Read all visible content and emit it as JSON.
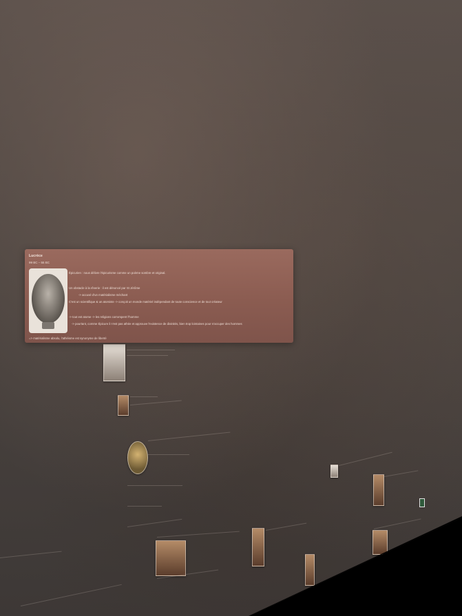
{
  "card": {
    "title": "Lucrèce",
    "dates": "99 BC – 55 BC",
    "lines": [
      "Épicurien : nous délivre l'épicurisme comme un poème sombre et original.",
      "Un obstacle à la rêverie : il est dénoncé par St Jérôme",
      "-> accusé d'un matérialisme méchant",
      "C'est un scientifique & un atomiste -> conçoit un monde matériel indépendant de toute conscience et de tout créateur",
      "-> tout est atome -> les religions corrompent l'homme",
      "-> pourtant, comme Épicure il n'est pas athée et approuve l'existence de divinités, bien trop lointaines pour s'occuper des hommes"
    ],
    "footer": "=> matérialisme absolu, l'athéisme est synonyme de liberté",
    "portrait_icon": "bust-portrait"
  },
  "background": {
    "colors": {
      "accent": "#8b5c51",
      "canvas": "#4b4440"
    }
  }
}
